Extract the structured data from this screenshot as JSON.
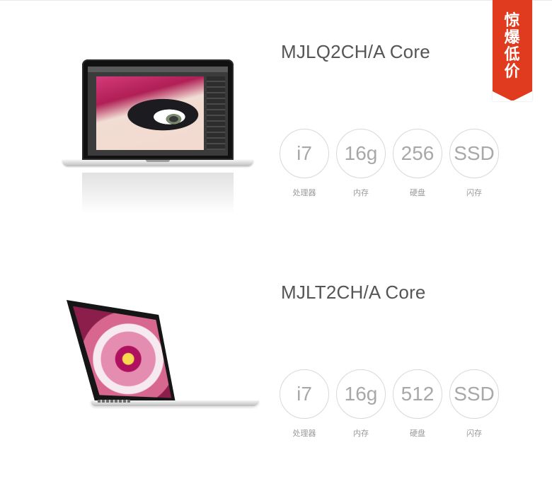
{
  "promo": {
    "lines": [
      "惊",
      "爆",
      "低",
      "价"
    ]
  },
  "products": [
    {
      "model": "MJLQ2CH/A Core",
      "specs": [
        {
          "value": "i7",
          "label": "处理器"
        },
        {
          "value": "16g",
          "label": "内存"
        },
        {
          "value": "256",
          "label": "硬盘"
        },
        {
          "value": "SSD",
          "label": "闪存"
        }
      ]
    },
    {
      "model": "MJLT2CH/A Core",
      "specs": [
        {
          "value": "i7",
          "label": "处理器"
        },
        {
          "value": "16g",
          "label": "内存"
        },
        {
          "value": "512",
          "label": "硬盘"
        },
        {
          "value": "SSD",
          "label": "闪存"
        }
      ]
    }
  ],
  "colors": {
    "promo_red": "#e03a1f",
    "text_main": "#555555",
    "spec_text": "#a8a8a8",
    "spec_label": "#9a9a9a",
    "circle_border": "#d8d8d8"
  }
}
